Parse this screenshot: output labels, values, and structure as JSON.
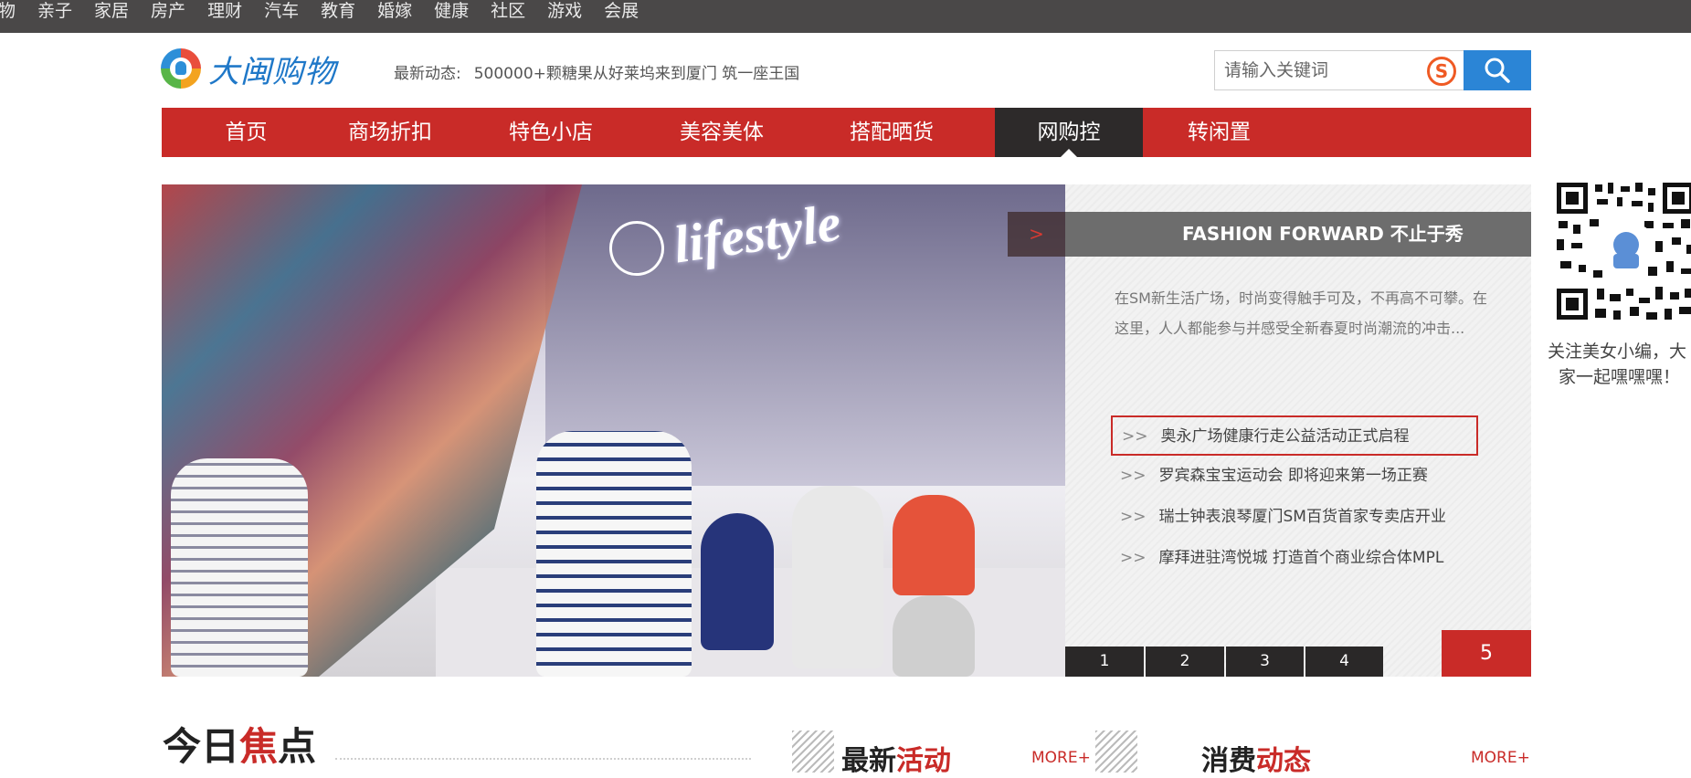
{
  "topbar": {
    "items": [
      "物",
      "亲子",
      "家居",
      "房产",
      "理财",
      "汽车",
      "教育",
      "婚嫁",
      "健康",
      "社区",
      "游戏",
      "会展"
    ]
  },
  "header": {
    "logo_text": "大闽购物",
    "news_label": "最新动态:",
    "news_text": "500000+颗糖果从好莱坞来到厦门 筑一座王国",
    "search_placeholder": "请输入关键词",
    "sogou_glyph": "S"
  },
  "mainnav": {
    "items": [
      "首页",
      "商场折扣",
      "特色小店",
      "美容美体",
      "搭配晒货",
      "网购控",
      "转闲置"
    ],
    "active_index": 5
  },
  "banner": {
    "sign_text": "lifestyle"
  },
  "panel": {
    "arrow": ">",
    "title": "FASHION FORWARD 不止于秀",
    "description": "在SM新生活广场，时尚变得触手可及，不再高不可攀。在这里，人人都能参与并感受全新春夏时尚潮流的冲击...",
    "links": [
      {
        "prefix": ">>",
        "text": "奥永广场健康行走公益活动正式启程"
      },
      {
        "prefix": ">>",
        "text": "罗宾森宝宝运动会 即将迎来第一场正赛"
      },
      {
        "prefix": ">>",
        "text": "瑞士钟表浪琴厦门SM百货首家专卖店开业"
      },
      {
        "prefix": ">>",
        "text": "摩拜进驻湾悦城 打造首个商业综合体MPL"
      }
    ],
    "pages": [
      "1",
      "2",
      "3",
      "4",
      "5"
    ],
    "active_page": "5"
  },
  "qr": {
    "caption_line1": "关注美女小编，大",
    "caption_line2": "家一起嘿嘿嘿！"
  },
  "sections": {
    "today_a": "今日",
    "today_b": "焦",
    "today_c": "点",
    "activity_a": "最新",
    "activity_b": "活动",
    "activity_more": "MORE+",
    "consume_a": "消费",
    "consume_b": "动态",
    "consume_more": "MORE+"
  },
  "colors": {
    "topbar": "#4a4848",
    "nav_red": "#c92b28",
    "nav_active": "#2d2a2a",
    "search_blue": "#2b85d6",
    "logo_blue": "#1f78c8"
  }
}
